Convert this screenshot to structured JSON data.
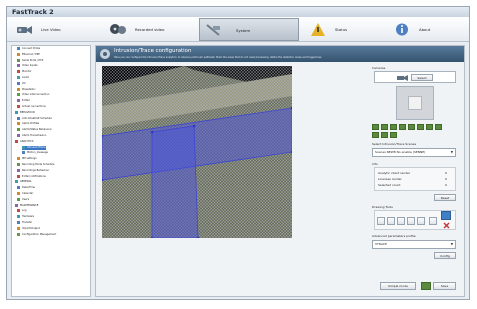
{
  "window": {
    "title": "FastTrack 2"
  },
  "tabs": [
    {
      "label": "Live Video",
      "icon": "camera-icon"
    },
    {
      "label": "Recorded video",
      "icon": "film-reel-icon"
    },
    {
      "label": "System",
      "icon": "system-icon"
    },
    {
      "label": "Status",
      "icon": "warning-icon"
    },
    {
      "label": "About",
      "icon": "info-icon"
    }
  ],
  "sidebar": {
    "items": [
      "Connect Probe",
      "Ethernet / PPP",
      "Serial Ports / PTZ",
      "Video Inputs",
      "Monitor",
      "Audio",
      "I/O",
      "Presets/Inc",
      "Video interconnection",
      "E-Mail",
      "Actual connections",
      "BEHAVIOUR",
      "Anti-Cheat/Alt Schedule",
      "Alarm Profiles",
      "Alarm/Status Behaviour",
      "Alarm Transmission",
      "ANALYTICS",
      "Intrusion/Trace",
      "Motion_message",
      "PIP settings",
      "Recording Mode Schedule",
      "Recordings Behaviour",
      "E-Mail notifications",
      "GENERAL",
      "Date/Time",
      "Calendar",
      "Users",
      "MAINTENANCE",
      "Log",
      "Hardware",
      "Transfer",
      "Import/Output",
      "Configuration Management"
    ]
  },
  "banner": {
    "title": "Intrusion/Trace configuration",
    "description": "Here you can configure the Intrusion/Trace analytics, to observe particular pathwalk. Mark the areas that do not need processing, define the detection areas and triggerlines."
  },
  "right": {
    "cameras_label": "Cameras",
    "select_label": "Select",
    "select_scene_label": "Select Intrusion/Trace Scenes",
    "scene_value": "Scenes NEW8 No enable (SENNE)",
    "info_label": "Info",
    "info_rows": [
      {
        "k": "Analytic client render",
        "v": "0"
      },
      {
        "k": "Licenses render",
        "v": "0"
      },
      {
        "k": "Selected count",
        "v": "0"
      }
    ],
    "reset_label": "Reset",
    "drawing_tools_label": "Drawing Tools",
    "advanced_label": "Advanced parameters profile",
    "profile_value": "VTRACE",
    "config_label": "Config",
    "simple_mode_label": "Simple mode",
    "save_label": "Save"
  },
  "colors": {
    "banner": "#3d5c79",
    "selection": "#3976c4",
    "overlay": "#4a53e0",
    "green_button": "#5b8a3e"
  }
}
